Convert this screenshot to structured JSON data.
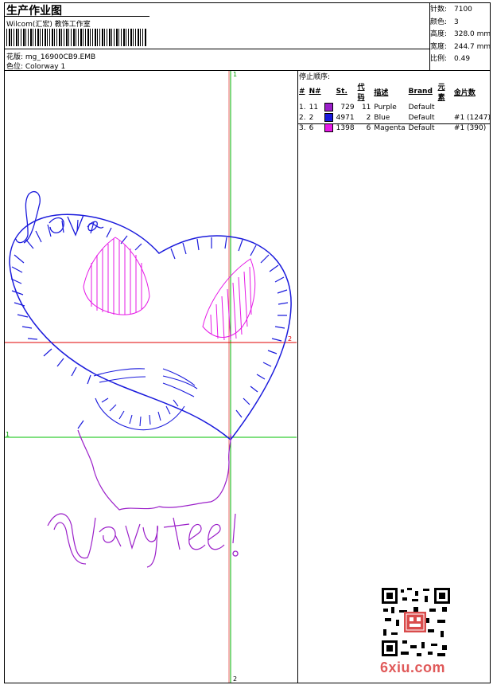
{
  "header": {
    "title": "生产作业图",
    "company": "Wilcom(汇宏) 教饰工作室",
    "design_label": "花版: mg_16900CB9.EMB",
    "colorway_label": "色位: Colorway 1"
  },
  "stats": [
    {
      "label": "针数:",
      "value": "7100"
    },
    {
      "label": "颜色:",
      "value": "3"
    },
    {
      "label": "高度:",
      "value": "328.0 mm"
    },
    {
      "label": "宽度:",
      "value": "244.7 mm"
    },
    {
      "label": "比例:",
      "value": "0.49"
    }
  ],
  "stop_sequence": {
    "title": "停止顺序:",
    "headers": [
      "#",
      "N#",
      "St.",
      "代码",
      "描述",
      "Brand",
      "元素",
      "金片数"
    ],
    "rows": [
      {
        "n": "1.",
        "needle": "11",
        "color": "#9b1fc9",
        "stitches": "729",
        "code": "11",
        "desc": "Purple",
        "brand": "Default",
        "elements": "",
        "sequins": ""
      },
      {
        "n": "2.",
        "needle": "2",
        "color": "#1a1adc",
        "stitches": "4971",
        "code": "2",
        "desc": "Blue",
        "brand": "Default",
        "elements": "",
        "sequins": "#1 (1247)"
      },
      {
        "n": "3.",
        "needle": "6",
        "color": "#e619e6",
        "stitches": "1398",
        "code": "6",
        "desc": "Magenta",
        "brand": "Default",
        "elements": "",
        "sequins": "#1 (390)"
      }
    ]
  },
  "design_text": {
    "top_word": "Love",
    "bottom_words": "Navy tee!"
  },
  "markers": {
    "v_top": "1",
    "v_bottom": "2",
    "h_red": "2",
    "h_green": "1"
  },
  "watermark": "6xiu.com"
}
